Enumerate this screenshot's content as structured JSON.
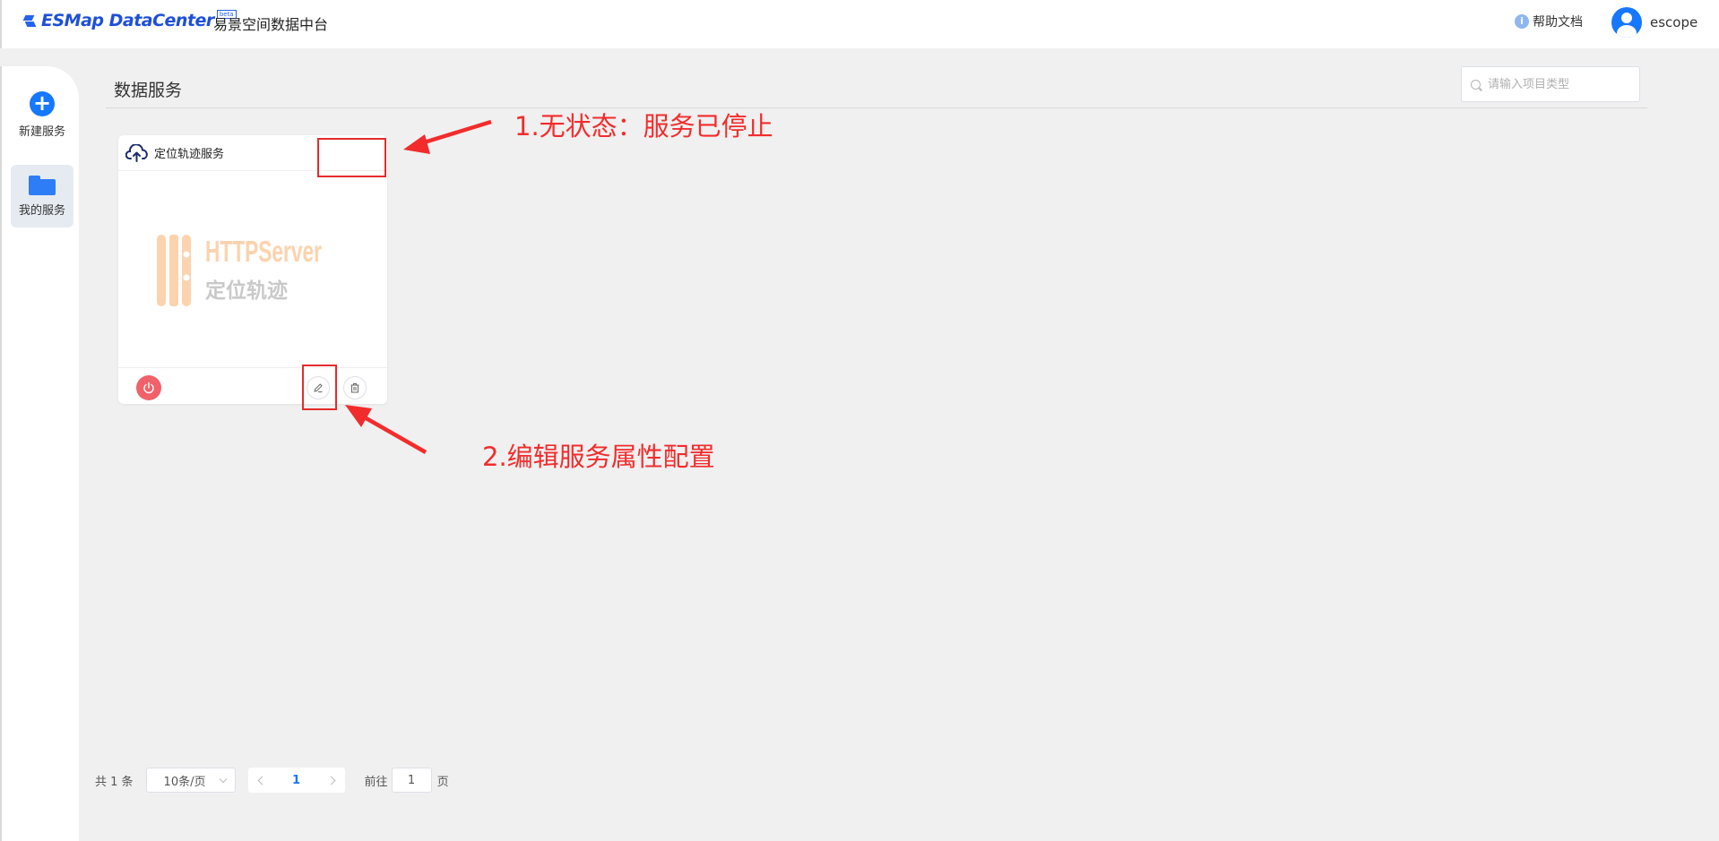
{
  "header": {
    "logo_text": "ESMap DataCenter",
    "logo_badge": "beta",
    "platform_name": "易景空间数据中台",
    "help_label": "帮助文档",
    "help_icon": "info-icon",
    "username": "escope"
  },
  "sidebar": {
    "items": [
      {
        "label": "新建服务",
        "icon": "plus-circle-icon"
      },
      {
        "label": "我的服务",
        "icon": "folder-icon"
      }
    ]
  },
  "main": {
    "title": "数据服务",
    "search_placeholder": "请输入项目类型"
  },
  "cards": [
    {
      "title": "定位轨迹服务",
      "thumbnail_title": "HTTPServer",
      "thumbnail_subtitle": "定位轨迹",
      "status_color": "#f0616a"
    }
  ],
  "annotations": [
    {
      "text": "1.无状态：服务已停止"
    },
    {
      "text": "2.编辑服务属性配置"
    }
  ],
  "pagination": {
    "total": "共 1 条",
    "page_size": "10条/页",
    "current_page": "1",
    "goto_prefix": "前往",
    "goto_value": "1",
    "goto_suffix": "页"
  },
  "colors": {
    "accent": "#1677ff",
    "annotation_red": "#f22c2c",
    "stop_button": "#f0616a",
    "thumbnail_orange": "#fbd3ae"
  }
}
